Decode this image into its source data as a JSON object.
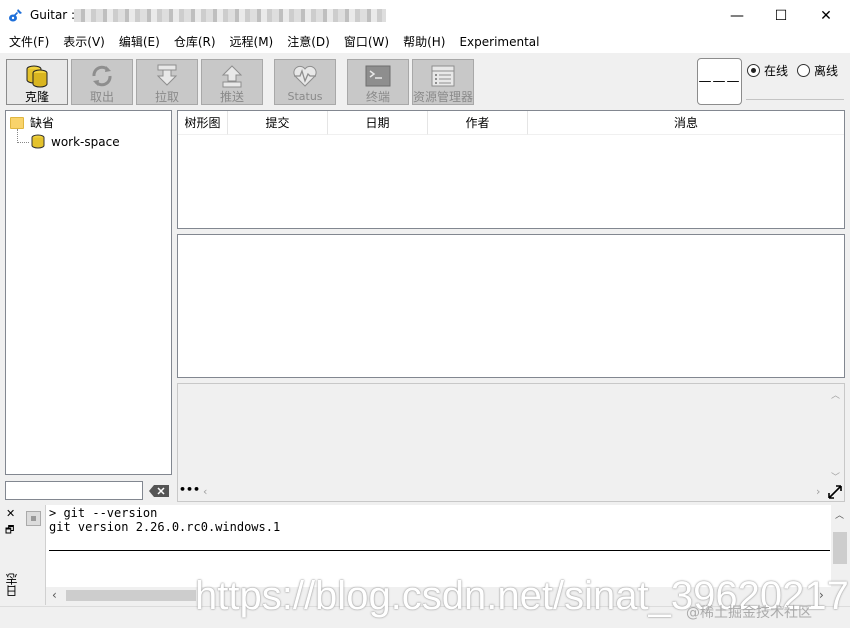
{
  "window": {
    "title": "Guitar : ",
    "min_symbol": "—",
    "max_symbol": "☐",
    "close_symbol": "✕"
  },
  "menu": [
    "文件(F)",
    "表示(V)",
    "编辑(E)",
    "仓库(R)",
    "远程(M)",
    "注意(D)",
    "窗口(W)",
    "帮助(H)",
    "Experimental"
  ],
  "toolbar": {
    "buttons": [
      {
        "label": "克隆",
        "icon": "database-icon",
        "enabled": true
      },
      {
        "label": "取出",
        "icon": "refresh-icon",
        "enabled": false
      },
      {
        "label": "拉取",
        "icon": "pull-icon",
        "enabled": false
      },
      {
        "label": "推送",
        "icon": "push-icon",
        "enabled": false
      },
      {
        "label": "Status",
        "icon": "heartbeat-icon",
        "enabled": false
      },
      {
        "label": "终端",
        "icon": "terminal-icon",
        "enabled": false
      },
      {
        "label": "资源管理器",
        "icon": "explorer-icon",
        "enabled": false
      }
    ],
    "status_box": "———",
    "online_label": "在线",
    "offline_label": "离线",
    "selected_mode": "在线"
  },
  "tree": {
    "root": "缺省",
    "children": [
      "work-space"
    ]
  },
  "filter": {
    "value": ""
  },
  "commit_table": {
    "columns": [
      "树形图",
      "提交",
      "日期",
      "作者",
      "消息"
    ]
  },
  "diff_panel": {
    "more_label": "•••"
  },
  "console": {
    "lines": [
      "> git --version",
      "git version 2.26.0.rc0.windows.1"
    ],
    "side_close": "✕",
    "side_float": "🗗",
    "side_label": "日志"
  },
  "watermark": "https://blog.csdn.net/sinat_39620217",
  "badge": "@稀土掘金技术社区",
  "colors": {
    "accent": "#1e6fd9",
    "disabled_btn": "#c8c8c8"
  }
}
